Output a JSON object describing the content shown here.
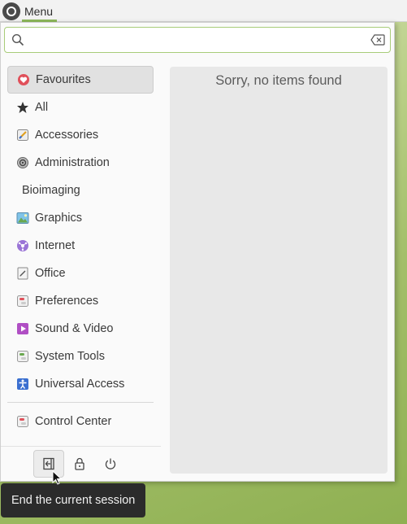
{
  "panel": {
    "menu_label": "Menu",
    "accent": "#8cb85a"
  },
  "search": {
    "value": "",
    "placeholder": ""
  },
  "sidebar": {
    "items": [
      {
        "label": "Favourites",
        "icon": "heart-icon"
      },
      {
        "label": "All",
        "icon": "star-icon"
      },
      {
        "label": "Accessories",
        "icon": "accessories-icon"
      },
      {
        "label": "Administration",
        "icon": "administration-icon"
      },
      {
        "label": "Bioimaging",
        "icon": ""
      },
      {
        "label": "Graphics",
        "icon": "graphics-icon"
      },
      {
        "label": "Internet",
        "icon": "internet-icon"
      },
      {
        "label": "Office",
        "icon": "office-icon"
      },
      {
        "label": "Preferences",
        "icon": "preferences-icon"
      },
      {
        "label": "Sound & Video",
        "icon": "sound-video-icon"
      },
      {
        "label": "System Tools",
        "icon": "system-tools-icon"
      },
      {
        "label": "Universal Access",
        "icon": "universal-access-icon"
      }
    ],
    "control_center": {
      "label": "Control Center",
      "icon": "control-center-icon"
    }
  },
  "results": {
    "empty_message": "Sorry, no items found"
  },
  "actions": {
    "logout_icon": "logout-icon",
    "lock_icon": "lock-icon",
    "power_icon": "power-icon"
  },
  "tooltip": {
    "text": "End the current session"
  }
}
